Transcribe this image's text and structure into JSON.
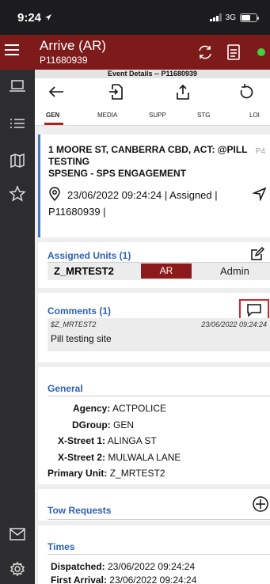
{
  "status_bar": {
    "time": "9:24",
    "network": "3G"
  },
  "header": {
    "title": "Arrive (AR)",
    "subtitle": "P11680939"
  },
  "event_bar": {
    "text": "Event Details -- P11680939"
  },
  "tabs": [
    {
      "label": "GEN"
    },
    {
      "label": "MEDIA"
    },
    {
      "label": "SUPP"
    },
    {
      "label": "STG"
    },
    {
      "label": "LOI"
    }
  ],
  "event": {
    "address_line1": "1 MOORE ST, CANBERRA CBD, ACT: @PILL",
    "address_line2": "TESTING",
    "address_line3": "SPSENG - SPS ENGAGEMENT",
    "priority": "P4",
    "datetime_status": "23/06/2022 09:24:24 | Assigned |",
    "event_id": "P11680939 |"
  },
  "assigned_units": {
    "title": "Assigned Units (1)",
    "unit": "Z_MRTEST2",
    "status": "AR",
    "role": "Admin"
  },
  "comments": {
    "title": "Comments (1)",
    "author": "$Z_MRTEST2",
    "time": "23/06/2022 09:24:24",
    "text": "Pill testing site"
  },
  "general": {
    "title": "General",
    "agency_label": "Agency:",
    "agency": "ACTPOLICE",
    "dgroup_label": "DGroup:",
    "dgroup": "GEN",
    "xstreet1_label": "X-Street 1:",
    "xstreet1": "ALINGA ST",
    "xstreet2_label": "X-Street 2:",
    "xstreet2": "MULWALA LANE",
    "primary_label": "Primary Unit:",
    "primary": "Z_MRTEST2"
  },
  "tow_requests": {
    "title": "Tow Requests"
  },
  "times": {
    "title": "Times",
    "dispatched_label": "Dispatched:",
    "dispatched": "23/06/2022 09:24:24",
    "first_arrival_label": "First Arrival:",
    "first_arrival": "23/06/2022 09:24:24"
  },
  "colors": {
    "header": "#7d1b1b",
    "accent_blue": "#2f62b3",
    "status_badge": "#8c1a1a",
    "highlight": "#d8262c"
  }
}
